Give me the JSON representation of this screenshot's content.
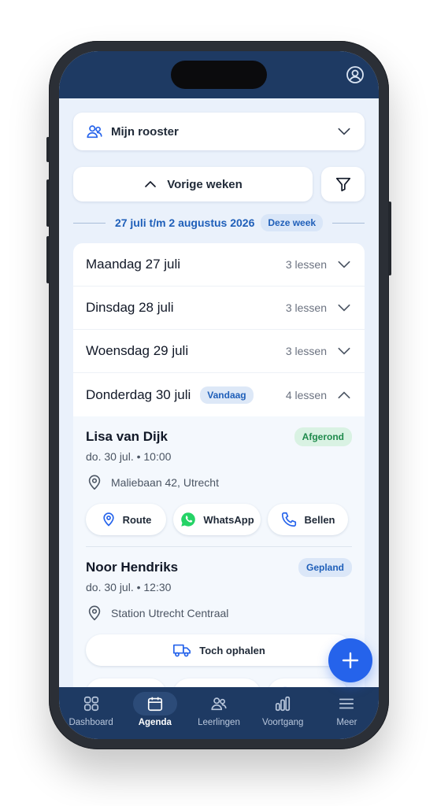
{
  "schedule_select": {
    "label": "Mijn rooster"
  },
  "previous_weeks": {
    "label": "Vorige weken"
  },
  "week": {
    "range": "27 juli t/m 2 augustus 2026",
    "badge": "Deze week"
  },
  "days": [
    {
      "name": "Maandag 27 juli",
      "count": "3 lessen",
      "expanded": false
    },
    {
      "name": "Dinsdag 28 juli",
      "count": "3 lessen",
      "expanded": false
    },
    {
      "name": "Woensdag 29 juli",
      "count": "3 lessen",
      "expanded": false
    },
    {
      "name": "Donderdag 30 juli",
      "badge": "Vandaag",
      "count": "4 lessen",
      "expanded": true
    }
  ],
  "lessons": [
    {
      "name": "Lisa van Dijk",
      "status": "Afgerond",
      "time": "do. 30 jul. • 10:00",
      "location": "Maliebaan 42, Utrecht"
    },
    {
      "name": "Noor Hendriks",
      "status": "Gepland",
      "time": "do. 30 jul. • 12:30",
      "location": "Station Utrecht Centraal",
      "pickup": "Toch ophalen"
    }
  ],
  "actions": {
    "route": "Route",
    "whatsapp": "WhatsApp",
    "call": "Bellen"
  },
  "tabs": [
    {
      "label": "Dashboard"
    },
    {
      "label": "Agenda"
    },
    {
      "label": "Leerlingen"
    },
    {
      "label": "Voortgang"
    },
    {
      "label": "Meer"
    }
  ],
  "colors": {
    "primary": "#1e3a63",
    "accent": "#2563eb",
    "done": "#1f8a4c",
    "whatsapp": "#25d366"
  }
}
